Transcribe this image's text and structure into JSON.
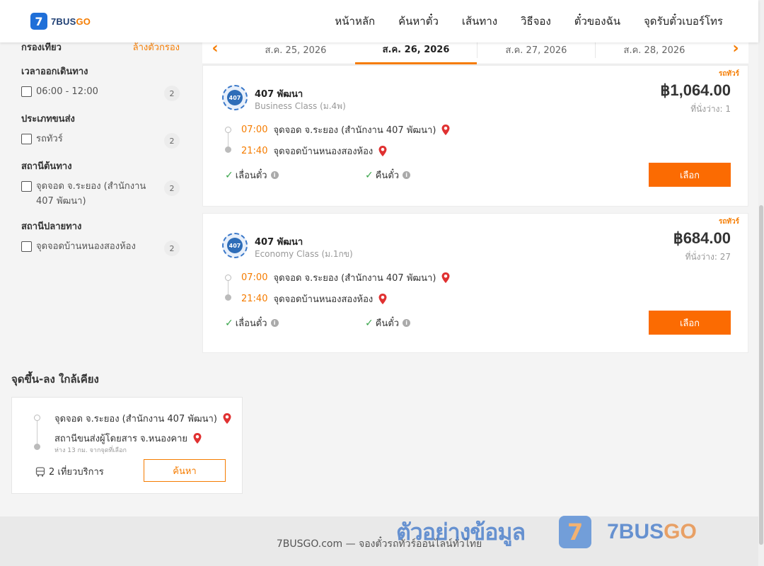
{
  "header": {
    "logo_mark": "7",
    "logo_text_main": "7BUS",
    "logo_text_accent": "GO",
    "nav": [
      "หน้าหลัก",
      "ค้นหาตั๋ว",
      "เส้นทาง",
      "วิธีจอง",
      "ตั๋วของฉัน",
      "จุดรับตั๋วเบอร์โทร"
    ]
  },
  "sidebar": {
    "title": "กรองเที่ยว",
    "clear": "ล้างตัวกรอง",
    "sections": [
      {
        "title": "เวลาออกเดินทาง",
        "options": [
          {
            "label": "06:00 - 12:00",
            "count": "2"
          }
        ]
      },
      {
        "title": "ประเภทขนส่ง",
        "options": [
          {
            "label": "รถทัวร์",
            "count": "2"
          }
        ]
      },
      {
        "title": "สถานีต้นทาง",
        "options": [
          {
            "label": "จุดจอด จ.ระยอง (สำนักงาน 407 พัฒนา)",
            "count": "2"
          }
        ]
      },
      {
        "title": "สถานีปลายทาง",
        "options": [
          {
            "label": "จุดจอดบ้านหนองสองห้อง",
            "count": "2"
          }
        ]
      }
    ]
  },
  "dates": {
    "prev_icon": "‹",
    "next_icon": "›",
    "tabs": [
      "ส.ค. 25, 2026",
      "ส.ค. 26, 2026",
      "ส.ค. 27, 2026",
      "ส.ค. 28, 2026"
    ],
    "active_index": 1
  },
  "trips": [
    {
      "type": "รถทัวร์",
      "logo_text": "407",
      "operator": "407 พัฒนา",
      "class": "Business Class (ม.4พ)",
      "price": "฿1,064.00",
      "seats": "ที่นั่งว่าง: 1",
      "depart_time": "07:00",
      "depart_stop": "จุดจอด จ.ระยอง (สำนักงาน 407 พัฒนา)",
      "arrive_time": "21:40",
      "arrive_stop": "จุดจอดบ้านหนองสองห้อง",
      "feature_1": "เลื่อนตั๋ว",
      "feature_2": "คืนตั๋ว",
      "select": "เลือก"
    },
    {
      "type": "รถทัวร์",
      "logo_text": "407",
      "operator": "407 พัฒนา",
      "class": "Economy Class (ม.1กข)",
      "price": "฿684.00",
      "seats": "ที่นั่งว่าง: 27",
      "depart_time": "07:00",
      "depart_stop": "จุดจอด จ.ระยอง (สำนักงาน 407 พัฒนา)",
      "arrive_time": "21:40",
      "arrive_stop": "จุดจอดบ้านหนองสองห้อง",
      "feature_1": "เลื่อนตั๋ว",
      "feature_2": "คืนตั๋ว",
      "select": "เลือก"
    }
  ],
  "nearby": {
    "title": "จุดขึ้น-ลง ใกล้เคียง",
    "from": "จุดจอด จ.ระยอง (สำนักงาน 407 พัฒนา)",
    "to": "สถานีขนส่งผู้โดยสาร จ.หนองคาย",
    "distance": "ห่าง 13 กม. จากจุดที่เลือก",
    "trips": "2 เที่ยวบริการ",
    "search": "ค้นหา"
  },
  "footer": {
    "text": "7BUSGO.com — จองตั๋วรถทัวร์ออนไลน์ทั่วไทย"
  },
  "watermark": {
    "text": "ตัวอย่างข้อมูล",
    "mark": "7",
    "brand_main": "7BUS",
    "brand_accent": "GO"
  },
  "colors": {
    "accent": "#f57c00",
    "button": "#fb6b02",
    "brand_blue": "#1f6fd8",
    "check_green": "#3aa54b"
  }
}
